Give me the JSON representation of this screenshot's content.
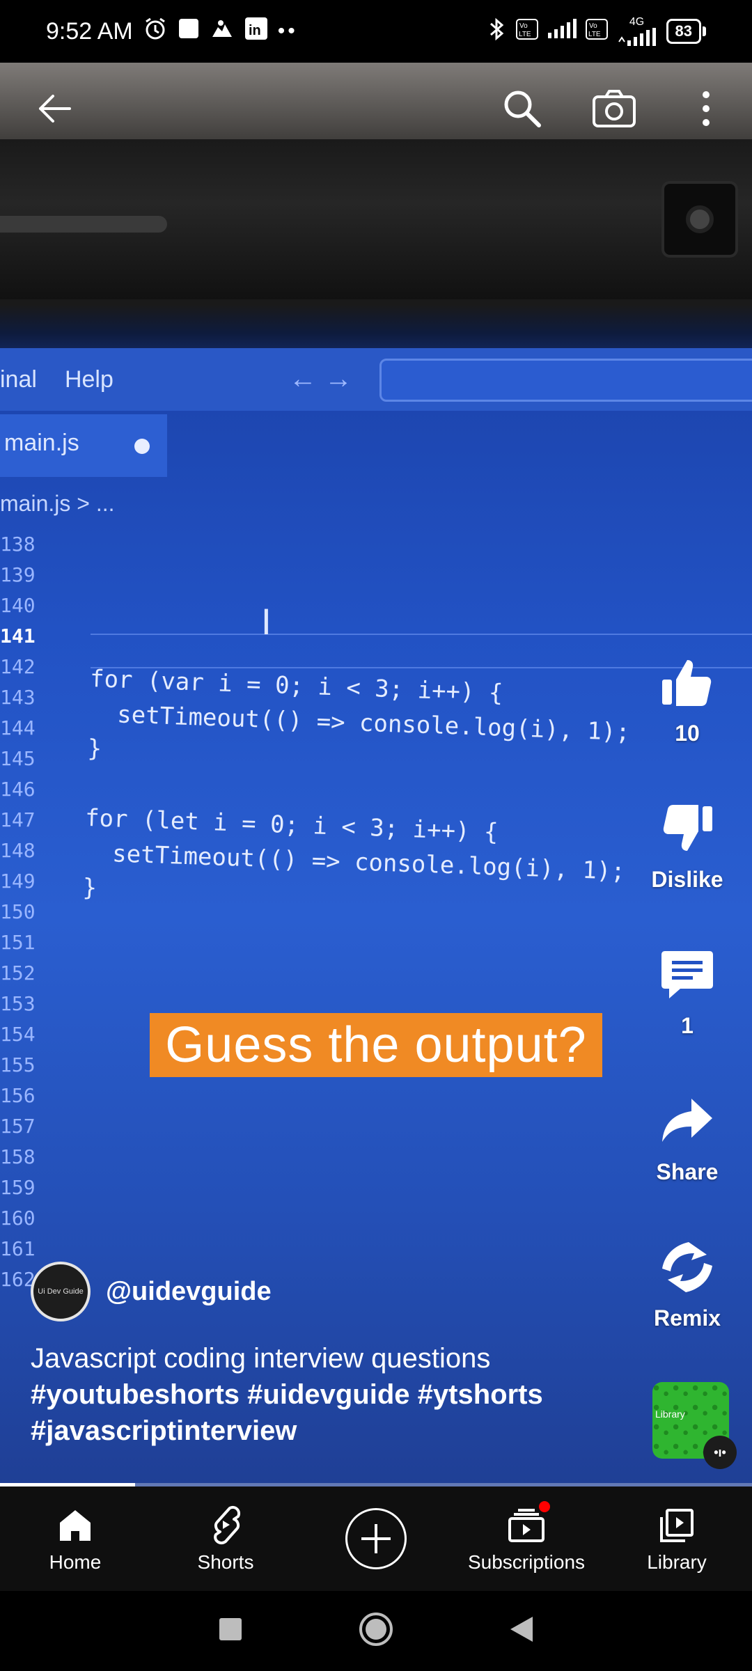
{
  "status_bar": {
    "time": "9:52 AM",
    "battery": "83",
    "network": "4G",
    "volte": "Vo LTE"
  },
  "video": {
    "editor_menu": [
      "inal",
      "Help"
    ],
    "tab_label": "main.js",
    "breadcrumb": "main.js > ...",
    "line_numbers": [
      "138",
      "139",
      "140",
      "141",
      "142",
      "143",
      "144",
      "145",
      "146",
      "147",
      "148",
      "149",
      "150",
      "151",
      "152",
      "153",
      "154",
      "155",
      "156",
      "157",
      "158",
      "159",
      "160",
      "161",
      "162"
    ],
    "code_lines": [
      "for (var i = 0; i < 3; i++) {",
      "  setTimeout(() => console.log(i), 1);",
      "}",
      "",
      "for (let i = 0; i < 3; i++) {",
      "  setTimeout(() => console.log(i), 1);",
      "}"
    ],
    "caption": "Guess the output?"
  },
  "actions": {
    "like_count": "10",
    "dislike_label": "Dislike",
    "comment_count": "1",
    "share_label": "Share",
    "remix_label": "Remix"
  },
  "channel": {
    "avatar_text": "Ui Dev Guide",
    "handle": "@uidevguide"
  },
  "description": {
    "title": "Javascript coding interview questions",
    "hashtags": "#youtubeshorts #uidevguide #ytshorts #javascriptinterview"
  },
  "sound": {
    "thumb_text": "Library"
  },
  "playback": {
    "progress_fraction": 0.18
  },
  "bottom_nav": {
    "home": "Home",
    "shorts": "Shorts",
    "subscriptions": "Subscriptions",
    "library": "Library"
  },
  "colors": {
    "caption_bg": "#f08a24",
    "notif_dot": "#ff0000",
    "video_blue": "#2252c4"
  }
}
